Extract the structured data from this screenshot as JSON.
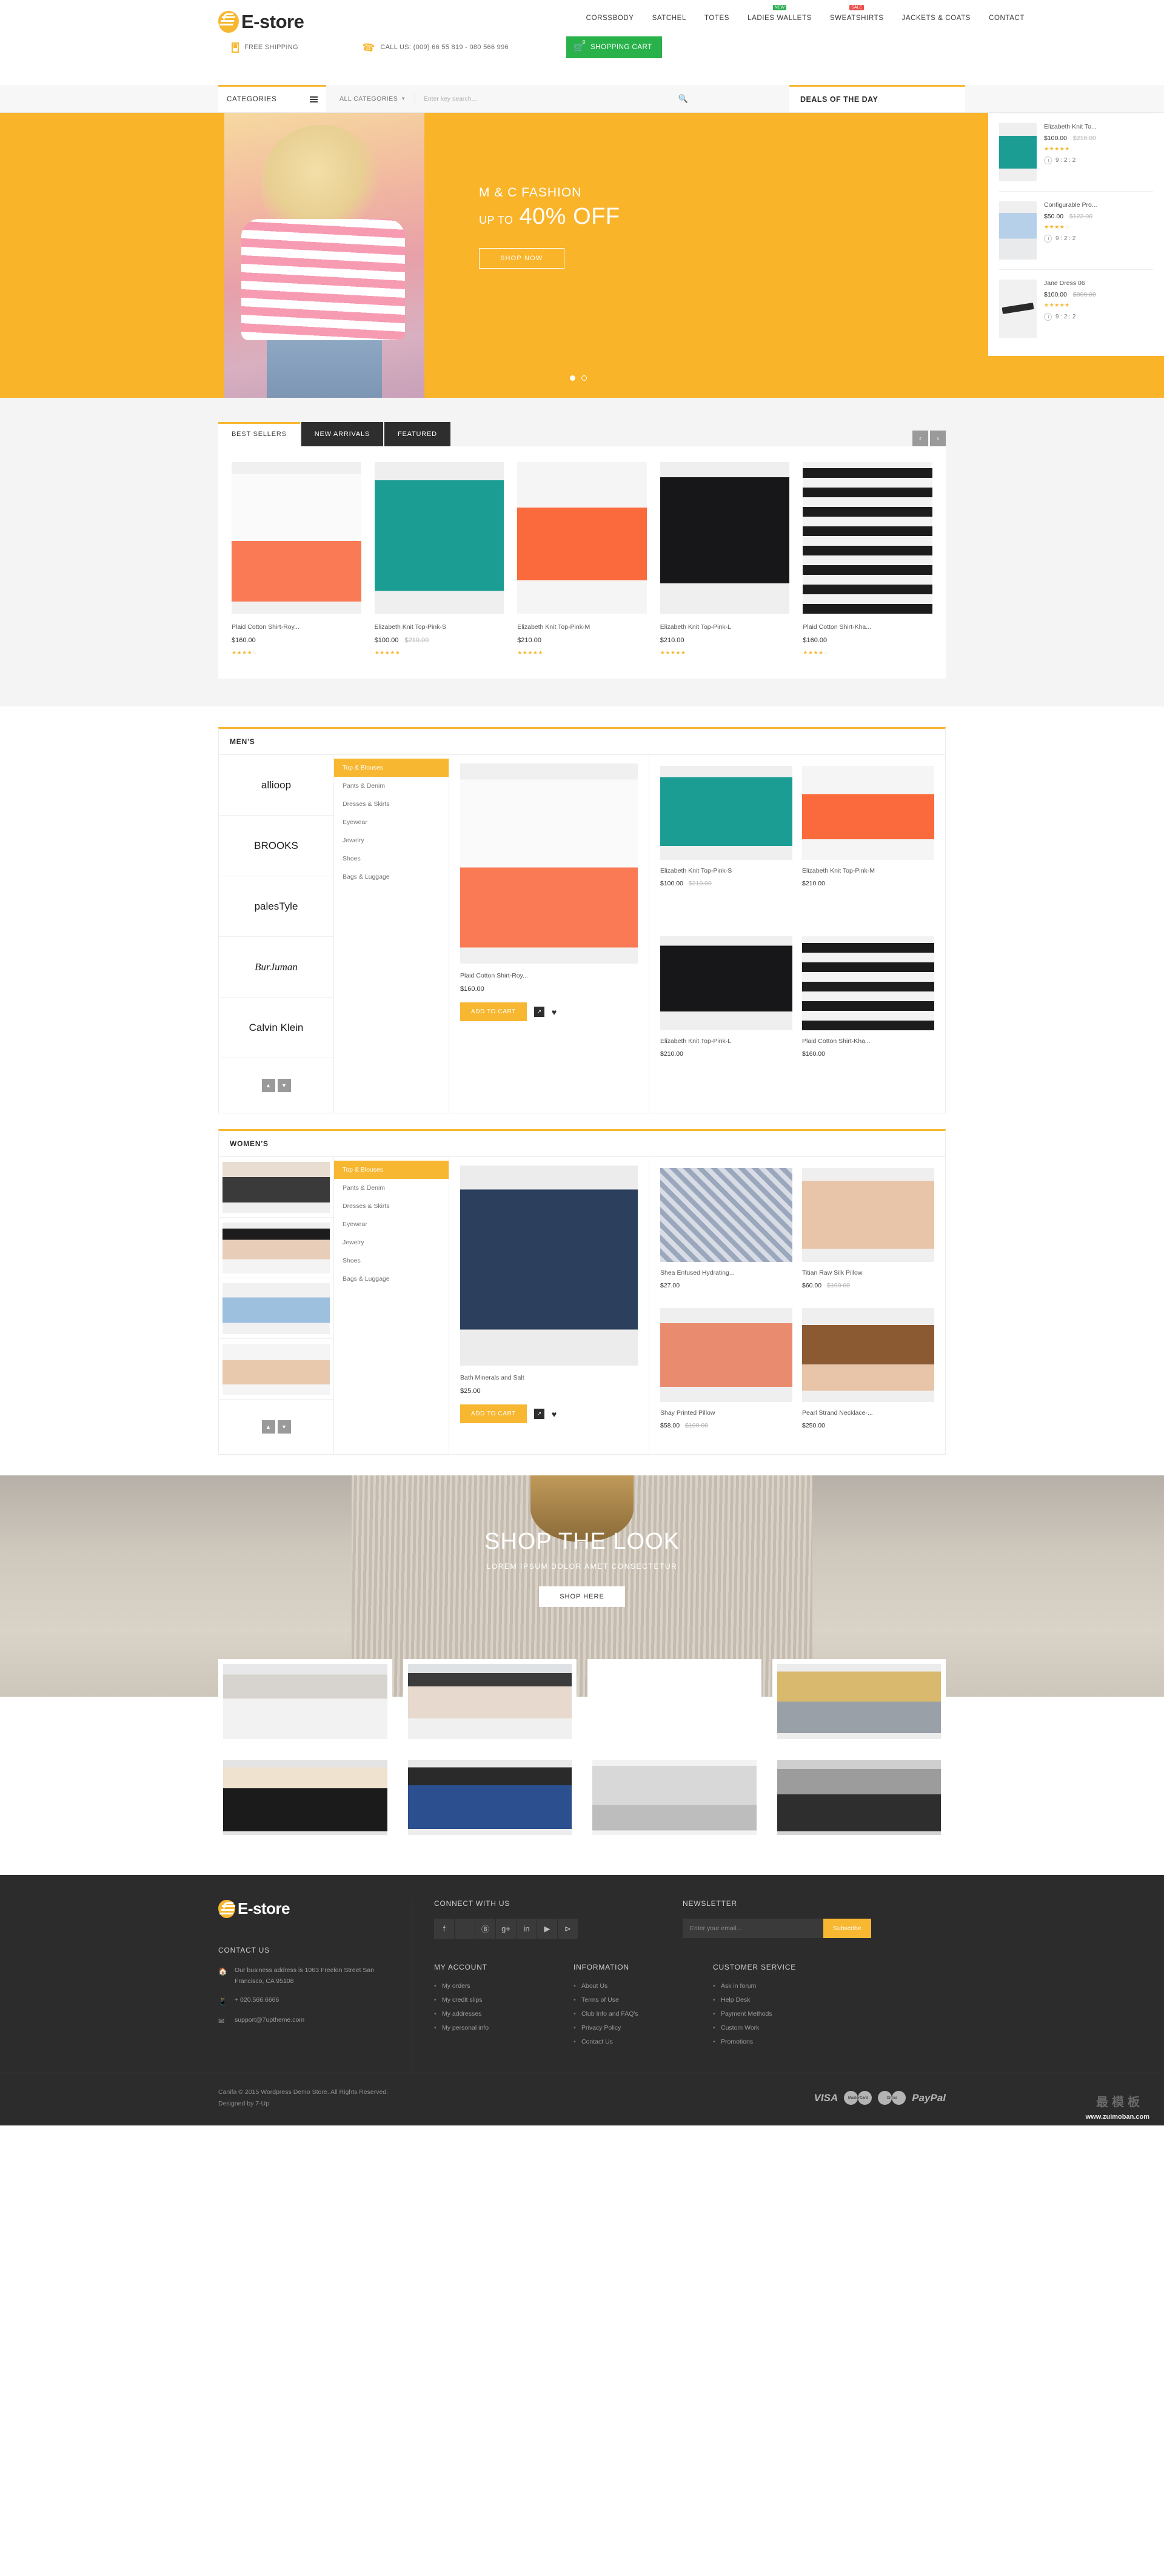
{
  "brand": {
    "name": "E-store"
  },
  "header": {
    "nav": [
      {
        "label": "CORSSBODY",
        "badge": null
      },
      {
        "label": "SATCHEL",
        "badge": null
      },
      {
        "label": "TOTES",
        "badge": null
      },
      {
        "label": "LADIES WALLETS",
        "badge": "NEW"
      },
      {
        "label": "SWEATSHIRTS",
        "badge": "SALE"
      },
      {
        "label": "JACKETS & COATS",
        "badge": null
      },
      {
        "label": "CONTACT",
        "badge": null
      }
    ],
    "free_shipping": "FREE SHIPPING",
    "call_us": "CALL US: (009) 66 55 819 - 080 566 996",
    "cart_label": "SHOPPING CART",
    "cart_count": "0"
  },
  "catbar": {
    "categories_label": "CATEGORIES",
    "all_categories": "ALL CATEGORIES",
    "search_placeholder": "Enter key search...",
    "deals_title": "DEALS OF THE DAY"
  },
  "hero": {
    "title": "M & C FASHION",
    "sub_small": "UP TO",
    "sub_big": "40% OFF",
    "button": "SHOP NOW"
  },
  "deals": [
    {
      "name": "Elizabeth Knit To...",
      "price": "$100.00",
      "old_price": "$210.00",
      "stars": 5,
      "timer": "9 : 2 : 2"
    },
    {
      "name": "Configurable Pro...",
      "price": "$50.00",
      "old_price": "$123.00",
      "stars": 4,
      "timer": "9 : 2 : 2"
    },
    {
      "name": "Jane Dress 06",
      "price": "$100.00",
      "old_price": "$800.00",
      "stars": 5,
      "timer": "9 : 2 : 2"
    }
  ],
  "tabs": [
    {
      "label": "BEST SELLERS",
      "active": true
    },
    {
      "label": "NEW ARRIVALS",
      "active": false
    },
    {
      "label": "FEATURED",
      "active": false
    }
  ],
  "best_sellers": [
    {
      "name": "Plaid Cotton Shirt-Roy...",
      "price": "$160.00",
      "old_price": "",
      "stars": 4
    },
    {
      "name": "Elizabeth Knit Top-Pink-S",
      "price": "$100.00",
      "old_price": "$210.00",
      "stars": 5
    },
    {
      "name": "Elizabeth Knit Top-Pink-M",
      "price": "$210.00",
      "old_price": "",
      "stars": 5
    },
    {
      "name": "Elizabeth Knit Top-Pink-L",
      "price": "$210.00",
      "old_price": "",
      "stars": 5
    },
    {
      "name": "Plaid Cotton Shirt-Kha...",
      "price": "$160.00",
      "old_price": "",
      "stars": 4
    }
  ],
  "mens": {
    "title": "MEN'S",
    "brands": [
      "allioop",
      "BROOKS",
      "palesTyle",
      "BurJuman",
      "Calvin Klein"
    ],
    "categories": [
      {
        "label": "Top & Blouses",
        "active": true
      },
      {
        "label": "Pants & Denim",
        "active": false
      },
      {
        "label": "Dresses & Skirts",
        "active": false
      },
      {
        "label": "Eyewear",
        "active": false
      },
      {
        "label": "Jewelry",
        "active": false
      },
      {
        "label": "Shoes",
        "active": false
      },
      {
        "label": "Bags & Luggage",
        "active": false
      }
    ],
    "feature": {
      "name": "Plaid Cotton Shirt-Roy...",
      "price": "$160.00",
      "add_to_cart": "ADD TO CART"
    },
    "grid": [
      {
        "name": "Elizabeth Knit Top-Pink-S",
        "price": "$100.00",
        "old_price": "$210.00"
      },
      {
        "name": "Elizabeth Knit Top-Pink-M",
        "price": "$210.00",
        "old_price": ""
      },
      {
        "name": "Elizabeth Knit Top-Pink-L",
        "price": "$210.00",
        "old_price": ""
      },
      {
        "name": "Plaid Cotton Shirt-Kha...",
        "price": "$160.00",
        "old_price": ""
      }
    ]
  },
  "womens": {
    "title": "WOMEN'S",
    "categories": [
      {
        "label": "Top & Blouses",
        "active": true
      },
      {
        "label": "Pants & Denim",
        "active": false
      },
      {
        "label": "Dresses & Skirts",
        "active": false
      },
      {
        "label": "Eyewear",
        "active": false
      },
      {
        "label": "Jewelry",
        "active": false
      },
      {
        "label": "Shoes",
        "active": false
      },
      {
        "label": "Bags & Luggage",
        "active": false
      }
    ],
    "feature": {
      "name": "Bath Minerals and Salt",
      "price": "$25.00",
      "add_to_cart": "ADD TO CART"
    },
    "grid": [
      {
        "name": "Shea Enfused Hydrating...",
        "price": "$27.00",
        "old_price": ""
      },
      {
        "name": "Titian Raw Silk Pillow",
        "price": "$60.00",
        "old_price": "$100.00"
      },
      {
        "name": "Shay Printed Pillow",
        "price": "$58.00",
        "old_price": "$100.00"
      },
      {
        "name": "Pearl Strand Necklace-...",
        "price": "$250.00",
        "old_price": ""
      }
    ]
  },
  "look": {
    "title": "SHOP THE LOOK",
    "subtitle": "LOREM IPSUM DOLOR AMET CONSECTETUR",
    "button": "SHOP HERE"
  },
  "footer": {
    "contact_title": "CONTACT US",
    "address": "Our business address is 1063 Freelon Street San Francisco, CA 95108",
    "phone": "+ 020.566.6666",
    "email": "support@7uptheme.com",
    "connect_title": "CONNECT WITH US",
    "social": [
      "facebook",
      "twitter",
      "pinterest",
      "google-plus",
      "linkedin",
      "youtube",
      "share"
    ],
    "newsletter_title": "NEWSLETTER",
    "newsletter_placeholder": "Enter your email...",
    "subscribe_label": "Subscribe",
    "columns": [
      {
        "title": "MY ACCOUNT",
        "items": [
          "My orders",
          "My credit slips",
          "My addresses",
          "My personal info"
        ]
      },
      {
        "title": "INFORMATION",
        "items": [
          "About Us",
          "Terms of Use",
          "Club Info and FAQ's",
          "Privacy Policy",
          "Contact Us"
        ]
      },
      {
        "title": "CUSTOMER SERVICE",
        "items": [
          "Ask in forum",
          "Help Desk",
          "Payment Methods",
          "Custom Work",
          "Promotions"
        ]
      }
    ],
    "copyright_line1": "Canifa © 2015 Wordpress Demo Store. All Rights Reserved.",
    "copyright_line2": "Designed by 7-Up",
    "payments": [
      "VISA",
      "MasterCard",
      "Cirrus",
      "PayPal"
    ],
    "watermark": "www.zuimoban.com"
  },
  "colors": {
    "accent": "#f7b731",
    "cart_green": "#29b24a",
    "dark": "#2c2c2c"
  }
}
